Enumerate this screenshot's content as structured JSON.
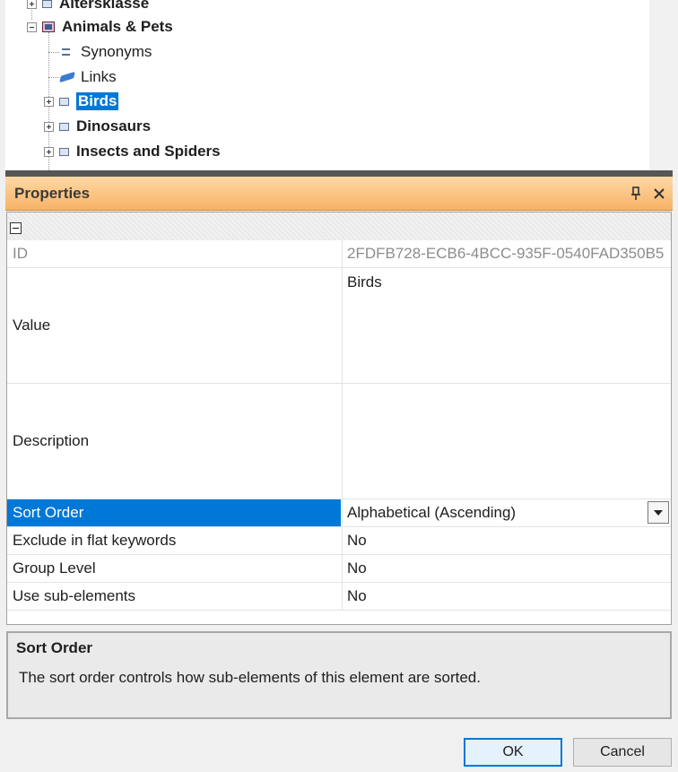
{
  "tree": {
    "nodes": [
      {
        "label": "Altersklasse",
        "bold": true,
        "expander": "plus",
        "icon": "node-icon"
      },
      {
        "label": "Animals & Pets",
        "bold": true,
        "expander": "minus",
        "icon": "root-node-icon"
      },
      {
        "label": "Synonyms",
        "bold": false,
        "icon": "synonyms-icon"
      },
      {
        "label": "Links",
        "bold": false,
        "icon": "link-icon"
      },
      {
        "label": "Birds",
        "bold": true,
        "expander": "plus",
        "icon": "node-icon",
        "selected": true
      },
      {
        "label": "Dinosaurs",
        "bold": true,
        "expander": "plus",
        "icon": "node-icon"
      },
      {
        "label": "Insects and Spiders",
        "bold": true,
        "expander": "plus",
        "icon": "node-icon"
      }
    ]
  },
  "properties": {
    "title": "Properties",
    "pin_icon": "pin-icon",
    "close_icon": "close-icon",
    "rows": [
      {
        "name": "ID",
        "value": "2FDFB728-ECB6-4BCC-935F-0540FAD350B5",
        "readonly": true
      },
      {
        "name": "Value",
        "value": "Birds"
      },
      {
        "name": "Description",
        "value": ""
      },
      {
        "name": "Sort Order",
        "value": "Alphabetical (Ascending)",
        "selected": true
      },
      {
        "name": "Exclude in flat keywords",
        "value": "No"
      },
      {
        "name": "Group Level",
        "value": "No"
      },
      {
        "name": "Use sub-elements",
        "value": "No"
      }
    ]
  },
  "help": {
    "title": "Sort Order",
    "description": "The sort order controls how sub-elements of this element are sorted."
  },
  "buttons": {
    "ok": "OK",
    "cancel": "Cancel"
  },
  "colors": {
    "selection": "#0078d7",
    "header_orange": "#f7b266"
  }
}
